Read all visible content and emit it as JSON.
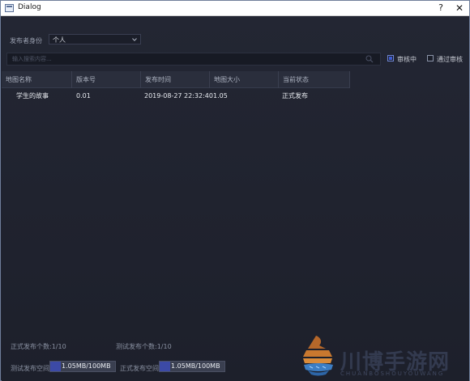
{
  "window": {
    "title": "Dialog",
    "help": "?",
    "close": "✕"
  },
  "form": {
    "faint_header": "",
    "identity_label": "发布者身份",
    "identity_value": "个人",
    "search_placeholder": "输入搜索内容...",
    "filter_reviewing": {
      "label": "审核中",
      "checked": true
    },
    "filter_passed": {
      "label": "通过审核",
      "checked": false
    }
  },
  "table": {
    "columns": [
      "地图名称",
      "版本号",
      "发布时间",
      "地图大小",
      "当前状态"
    ],
    "rows": [
      {
        "name": "学生的故事",
        "version": "0.01",
        "time": "2019-08-27 22:32:40",
        "size": "1.05",
        "status": "正式发布"
      }
    ]
  },
  "footer": {
    "official_count": "正式发布个数:1/10",
    "test_count": "测试发布个数:1/10",
    "test_space_label": "测试发布空间",
    "test_space_value": "1.05MB/100MB",
    "test_space_fraction": 0.0105,
    "official_space_label": "正式发布空间",
    "official_space_value": "1.05MB/100MB",
    "official_space_fraction": 0.0105
  },
  "watermark": {
    "text": "川博手游网",
    "sub": "CHUANBOSHOUYOUWANG"
  },
  "colors": {
    "accent": "#3e5bd0",
    "bg": "#1f2230",
    "header": "#2a2e3c"
  }
}
